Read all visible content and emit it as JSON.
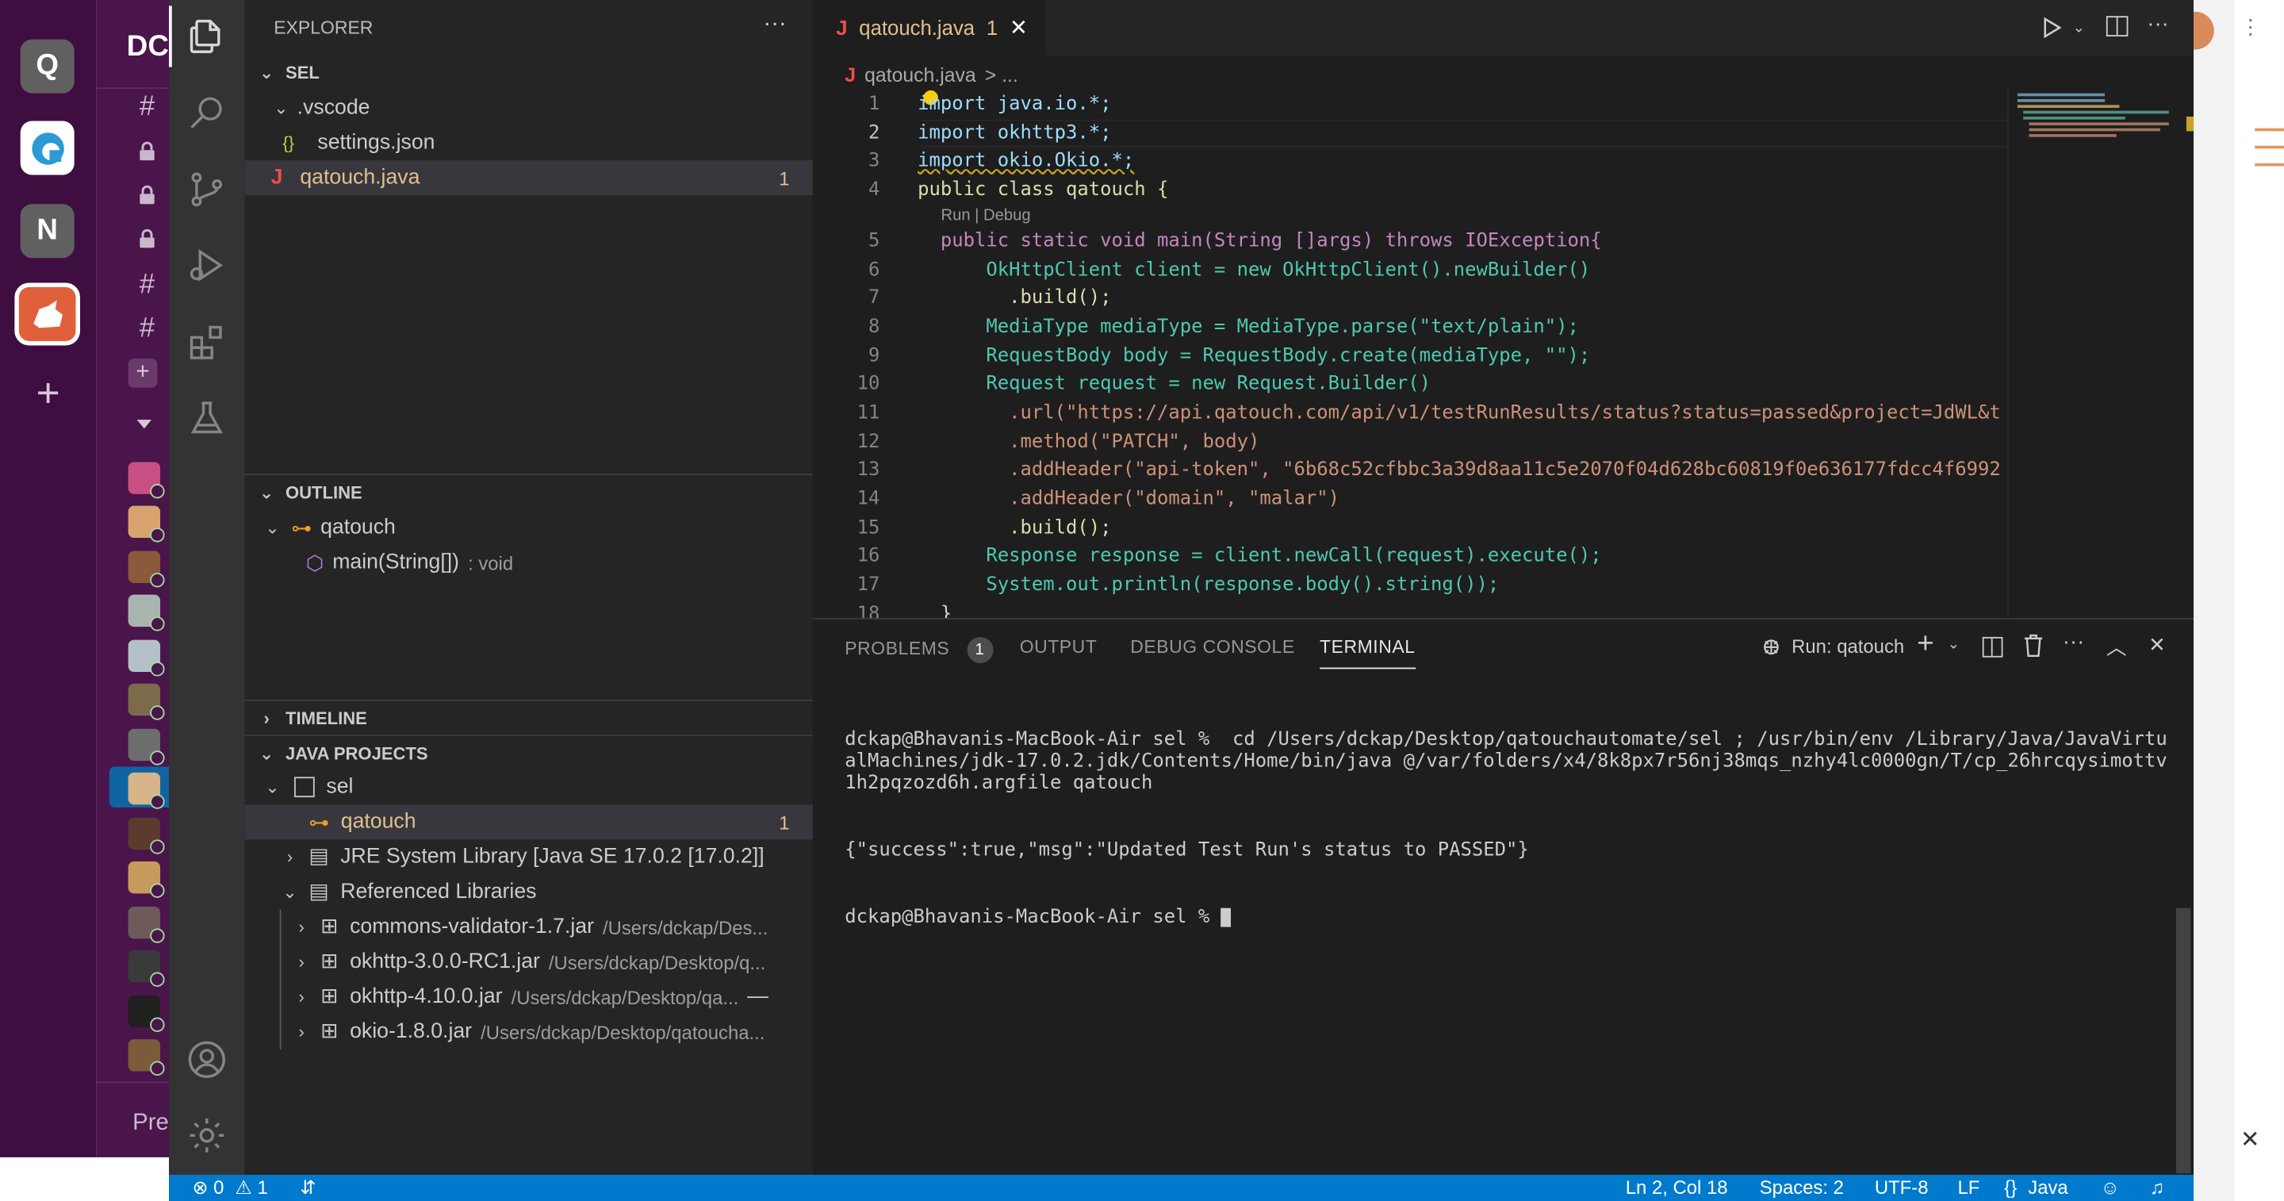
{
  "slack": {
    "workspaces": [
      {
        "letter": "Q",
        "color": "#616061"
      },
      {
        "letter": "",
        "color": "#ffffff"
      },
      {
        "letter": "N",
        "color": "#616061"
      },
      {
        "letter": "",
        "color": "#e0603b"
      }
    ],
    "add_label": "+",
    "side_title": "DC",
    "side_bottom": "Pre"
  },
  "explorer": {
    "title": "EXPLORER",
    "more": "···",
    "root": "SEL",
    "items": [
      {
        "label": ".vscode"
      },
      {
        "label": "settings.json",
        "icon": "{}"
      },
      {
        "label": "qatouch.java",
        "icon": "J",
        "badge": "1"
      }
    ]
  },
  "outline": {
    "title": "OUTLINE",
    "class_name": "qatouch",
    "method": "main(String[])",
    "method_type": ": void"
  },
  "timeline": {
    "title": "TIMELINE"
  },
  "java_projects": {
    "title": "JAVA PROJECTS",
    "project": "sel",
    "class_item": "qatouch",
    "class_badge": "1",
    "jre": "JRE System Library [Java SE 17.0.2 [17.0.2]]",
    "ref_libs": "Referenced Libraries",
    "jars": [
      {
        "name": "commons-validator-1.7.jar",
        "path": "/Users/dckap/Des..."
      },
      {
        "name": "okhttp-3.0.0-RC1.jar",
        "path": "/Users/dckap/Desktop/q..."
      },
      {
        "name": "okhttp-4.10.0.jar",
        "path": "/Users/dckap/Desktop/qa..."
      },
      {
        "name": "okio-1.8.0.jar",
        "path": "/Users/dckap/Desktop/qatoucha..."
      }
    ]
  },
  "editor": {
    "tab_label": "qatouch.java",
    "tab_badge": "1",
    "tab_icon": "J",
    "breadcrumb_file": "qatouch.java",
    "breadcrumb_rest": "> ...",
    "codelens": "Run | Debug",
    "line_numbers": [
      "1",
      "2",
      "3",
      "4",
      "5",
      "6",
      "7",
      "8",
      "9",
      "10",
      "11",
      "12",
      "13",
      "14",
      "15",
      "16",
      "17",
      "18"
    ],
    "code": [
      "import java.io.*;",
      "import okhttp3.*;",
      "import okio.Okio.*;",
      "public class qatouch {",
      "  public static void main(String []args) throws IOException{",
      "      OkHttpClient client = new OkHttpClient().newBuilder()",
      "        .build();",
      "      MediaType mediaType = MediaType.parse(\"text/plain\");",
      "      RequestBody body = RequestBody.create(mediaType, \"\");",
      "      Request request = new Request.Builder()",
      "        .url(\"https://api.qatouch.com/api/v1/testRunResults/status?status=passed&project=JdWL&t",
      "        .method(\"PATCH\", body)",
      "        .addHeader(\"api-token\", \"6b68c52cfbbc3a39d8aa11c5e2070f04d628bc60819f0e636177fdcc4f6992",
      "        .addHeader(\"domain\", \"malar\")",
      "        .build();",
      "      Response response = client.newCall(request).execute();",
      "      System.out.println(response.body().string());",
      "  }"
    ]
  },
  "panel": {
    "tabs": [
      {
        "label": "PROBLEMS",
        "count": "1"
      },
      {
        "label": "OUTPUT"
      },
      {
        "label": "DEBUG CONSOLE"
      },
      {
        "label": "TERMINAL"
      }
    ],
    "run_label": "Run: qatouch",
    "terminal_lines": [
      "dckap@Bhavanis-MacBook-Air sel %  cd /Users/dckap/Desktop/qatouchautomate/sel ; /usr/bin/env /Library/Java/JavaVirtualMachines/jdk-17.0.2.jdk/Contents/Home/bin/java @/var/folders/x4/8k8px7r56nj38mqs_nzhy4lc0000gn/T/cp_26hrcqysimottv1h2pqzozd6h.argfile qatouch",
      "{\"success\":true,\"msg\":\"Updated Test Run's status to PASSED\"}",
      "dckap@Bhavanis-MacBook-Air sel % "
    ]
  },
  "status": {
    "errors": "0",
    "warnings": "1",
    "position": "Ln 2, Col 18",
    "spaces": "Spaces: 2",
    "encoding": "UTF-8",
    "eol": "LF",
    "language": "Java",
    "language_icon": "{}"
  },
  "colors": {
    "statusbar": "#007acc",
    "sidebar": "#252526",
    "editor": "#1e1e1e",
    "slack": "#4a154b",
    "modified": "#e2c08d",
    "java_icon": "#f14c4c"
  }
}
